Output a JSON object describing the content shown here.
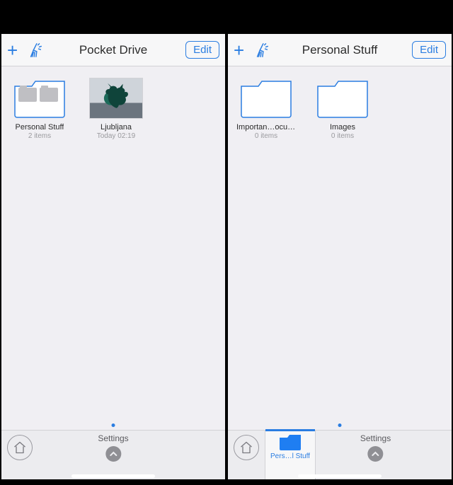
{
  "colors": {
    "accent": "#2a7de1"
  },
  "screens": [
    {
      "nav": {
        "title": "Pocket Drive",
        "edit": "Edit"
      },
      "items": [
        {
          "kind": "folder_preview",
          "title": "Personal Stuff",
          "sub": "2 items"
        },
        {
          "kind": "image",
          "title": "Ljubljana",
          "sub": "Today 02:19"
        }
      ],
      "bottom": {
        "center_label": "Settings",
        "active_tab": null
      }
    },
    {
      "nav": {
        "title": "Personal Stuff",
        "edit": "Edit"
      },
      "items": [
        {
          "kind": "folder",
          "title": "Importan…ocuments",
          "sub": "0 items"
        },
        {
          "kind": "folder",
          "title": "Images",
          "sub": "0 items"
        }
      ],
      "bottom": {
        "center_label": "Settings",
        "active_tab": {
          "label": "Pers…l Stuff"
        }
      }
    }
  ]
}
